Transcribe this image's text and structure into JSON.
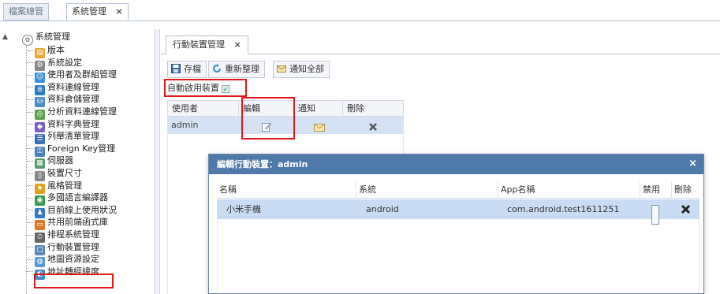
{
  "outer_tabs": [
    {
      "label": "檔案總管"
    },
    {
      "label": "系統管理",
      "close": "×"
    }
  ],
  "tree": {
    "root": "系統管理",
    "items": [
      {
        "label": "版本",
        "icon": "document-icon",
        "color": "#e6a83a"
      },
      {
        "label": "系統設定",
        "icon": "settings-icon",
        "color": "#8a8a8a"
      },
      {
        "label": "使用者及群組管理",
        "icon": "users-icon",
        "color": "#3a8fd6"
      },
      {
        "label": "資料連線管理",
        "icon": "database-icon",
        "color": "#2e7bbf"
      },
      {
        "label": "資料倉儲管理",
        "icon": "warehouse-icon",
        "color": "#4c8ac9"
      },
      {
        "label": "分析資料連線管理",
        "icon": "analysis-icon",
        "color": "#5aa34d"
      },
      {
        "label": "資料字典管理",
        "icon": "dictionary-icon",
        "color": "#7b5fc2"
      },
      {
        "label": "列舉清單管理",
        "icon": "list-icon",
        "color": "#3b6fb6"
      },
      {
        "label": "Foreign Key管理",
        "icon": "key-icon",
        "color": "#4b7fc0"
      },
      {
        "label": "伺服器",
        "icon": "server-icon",
        "color": "#5c9c6c"
      },
      {
        "label": "裝置尺寸",
        "icon": "device-icon",
        "color": "#888888"
      },
      {
        "label": "風格管理",
        "icon": "style-icon",
        "color": "#e0a21e"
      },
      {
        "label": "多國語言編譯器",
        "icon": "language-icon",
        "color": "#3a9a4f"
      },
      {
        "label": "目前線上使用狀況",
        "icon": "online-user-icon",
        "color": "#3a78c4"
      },
      {
        "label": "共用前端函式庫",
        "icon": "library-icon",
        "color": "#d9772b"
      },
      {
        "label": "排程系統管理",
        "icon": "schedule-icon",
        "color": "#666666"
      },
      {
        "label": "行動裝置管理",
        "icon": "mobile-device-icon",
        "color": "#5c86b8"
      },
      {
        "label": "地圖資源設定",
        "icon": "map-icon",
        "color": "#5a9ad4"
      },
      {
        "label": "地址轉經緯度",
        "icon": "geocode-icon",
        "color": "#4a8ac8"
      }
    ]
  },
  "inner_tab": {
    "label": "行動裝置管理",
    "close": "×"
  },
  "toolbar": {
    "save": "存檔",
    "refresh": "重新整理",
    "notify_all": "通知全部"
  },
  "auto_enable": {
    "label": "自動啟用裝置",
    "checked": "✔"
  },
  "device_grid": {
    "columns": [
      "使用者",
      "編輯",
      "通知",
      "刪除"
    ],
    "rows": [
      {
        "user": "admin"
      }
    ]
  },
  "dialog": {
    "title": "編輯行動裝置：admin",
    "close": "×",
    "columns": [
      "名稱",
      "系統",
      "App名稱",
      "禁用",
      "刪除"
    ],
    "rows": [
      {
        "name": "小米手機",
        "os": "android",
        "app": "com.android.test1611251",
        "disabled": false
      }
    ]
  }
}
